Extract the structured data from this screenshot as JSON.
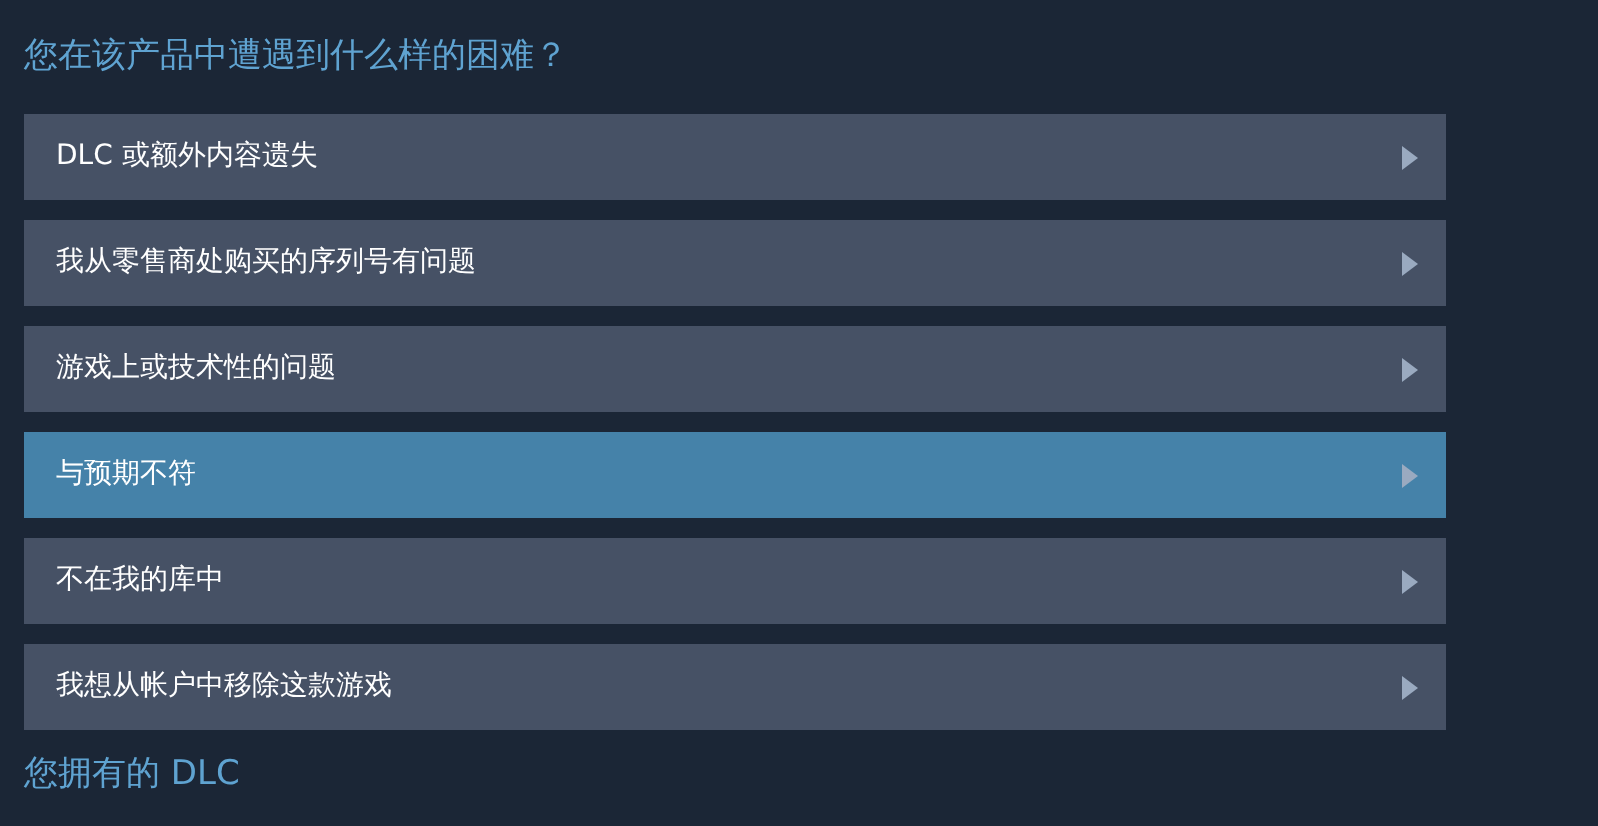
{
  "heading": "您在该产品中遭遇到什么样的困难？",
  "options": [
    {
      "label": "DLC 或额外内容遗失",
      "selected": false
    },
    {
      "label": "我从零售商处购买的序列号有问题",
      "selected": false
    },
    {
      "label": "游戏上或技术性的问题",
      "selected": false
    },
    {
      "label": "与预期不符",
      "selected": true
    },
    {
      "label": "不在我的库中",
      "selected": false
    },
    {
      "label": "我想从帐户中移除这款游戏",
      "selected": false
    }
  ],
  "next_heading": "您拥有的 DLC"
}
